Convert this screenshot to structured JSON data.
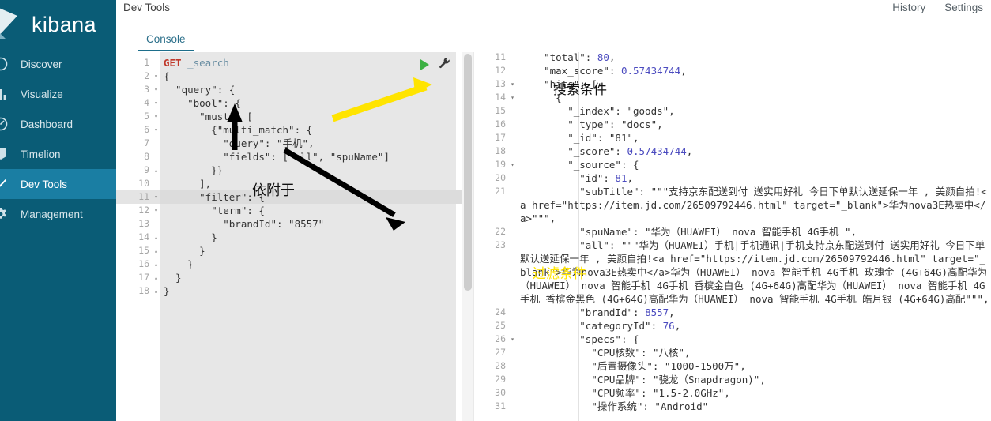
{
  "sidebar": {
    "brand": "kibana",
    "items": [
      {
        "label": "Discover",
        "icon": "compass-icon",
        "active": false
      },
      {
        "label": "Visualize",
        "icon": "barchart-icon",
        "active": false
      },
      {
        "label": "Dashboard",
        "icon": "gauge-icon",
        "active": false
      },
      {
        "label": "Timelion",
        "icon": "clock-icon",
        "active": false
      },
      {
        "label": "Dev Tools",
        "icon": "wrench-icon",
        "active": true
      },
      {
        "label": "Management",
        "icon": "gear-icon",
        "active": false
      }
    ]
  },
  "header": {
    "app_title": "Dev Tools",
    "links": [
      "History",
      "Settings"
    ]
  },
  "tabs": [
    {
      "label": "Console",
      "selected": true
    }
  ],
  "editor": {
    "actions": {
      "run": "play-icon",
      "settings": "wrench-icon"
    },
    "highlight_line": 11,
    "lines": [
      {
        "n": 1,
        "fold": "",
        "text": "GET _search"
      },
      {
        "n": 2,
        "fold": "▾",
        "text": "{"
      },
      {
        "n": 3,
        "fold": "▾",
        "text": "  \"query\": {"
      },
      {
        "n": 4,
        "fold": "▾",
        "text": "    \"bool\": {"
      },
      {
        "n": 5,
        "fold": "▾",
        "text": "      \"must\": ["
      },
      {
        "n": 6,
        "fold": "▾",
        "text": "        {\"multi_match\": {"
      },
      {
        "n": 7,
        "fold": "",
        "text": "          \"query\": \"手机\","
      },
      {
        "n": 8,
        "fold": "",
        "text": "          \"fields\": [\"all\", \"spuName\"]"
      },
      {
        "n": 9,
        "fold": "▴",
        "text": "        }}"
      },
      {
        "n": 10,
        "fold": "",
        "text": "      ],"
      },
      {
        "n": 11,
        "fold": "▾",
        "text": "      \"filter\": {"
      },
      {
        "n": 12,
        "fold": "▾",
        "text": "        \"term\": {"
      },
      {
        "n": 13,
        "fold": "",
        "text": "          \"brandId\": \"8557\""
      },
      {
        "n": 14,
        "fold": "▴",
        "text": "        }"
      },
      {
        "n": 15,
        "fold": "▴",
        "text": "      }"
      },
      {
        "n": 16,
        "fold": "▴",
        "text": "    }"
      },
      {
        "n": 17,
        "fold": "▴",
        "text": "  }"
      },
      {
        "n": 18,
        "fold": "▴",
        "text": "}"
      }
    ]
  },
  "output": {
    "lines": [
      {
        "n": 11,
        "fold": "",
        "text": "    \"total\": 80,"
      },
      {
        "n": 12,
        "fold": "",
        "text": "    \"max_score\": 0.57434744,"
      },
      {
        "n": 13,
        "fold": "▾",
        "text": "    \"hits\": ["
      },
      {
        "n": 14,
        "fold": "▾",
        "text": "      {"
      },
      {
        "n": 15,
        "fold": "",
        "text": "        \"_index\": \"goods\","
      },
      {
        "n": 16,
        "fold": "",
        "text": "        \"_type\": \"docs\","
      },
      {
        "n": 17,
        "fold": "",
        "text": "        \"_id\": \"81\","
      },
      {
        "n": 18,
        "fold": "",
        "text": "        \"_score\": 0.57434744,"
      },
      {
        "n": 19,
        "fold": "▾",
        "text": "        \"_source\": {"
      },
      {
        "n": 20,
        "fold": "",
        "text": "          \"id\": 81,"
      },
      {
        "n": 21,
        "fold": "",
        "text": "          \"subTitle\": \"\"\"支持京东配送到付 送实用好礼 今日下单默认送延保一年 , 美颜自拍!<a href=\"https://item.jd.com/26509792446.html\" target=\"_blank\">华为nova3E热卖中</a>\"\"\","
      },
      {
        "n": 22,
        "fold": "",
        "text": "          \"spuName\": \"华为（HUAWEI） nova 智能手机 4G手机 \","
      },
      {
        "n": 23,
        "fold": "",
        "text": "          \"all\": \"\"\"华为（HUAWEI）手机|手机通讯|手机支持京东配送到付 送实用好礼 今日下单默认送延保一年 , 美颜自拍!<a href=\"https://item.jd.com/26509792446.html\" target=\"_blank\">华为nova3E热卖中</a>华为（HUAWEI） nova 智能手机 4G手机 玫瑰金 (4G+64G)高配华为（HUAWEI） nova 智能手机 4G手机 香槟金白色 (4G+64G)高配华为（HUAWEI） nova 智能手机 4G手机 香槟金黑色 (4G+64G)高配华为（HUAWEI） nova 智能手机 4G手机 皓月银 (4G+64G)高配\"\"\","
      },
      {
        "n": 24,
        "fold": "",
        "text": "          \"brandId\": 8557,"
      },
      {
        "n": 25,
        "fold": "",
        "text": "          \"categoryId\": 76,"
      },
      {
        "n": 26,
        "fold": "▾",
        "text": "          \"specs\": {"
      },
      {
        "n": 27,
        "fold": "",
        "text": "            \"CPU核数\": \"八核\","
      },
      {
        "n": 28,
        "fold": "",
        "text": "            \"后置摄像头\": \"1000-1500万\","
      },
      {
        "n": 29,
        "fold": "",
        "text": "            \"CPU品牌\": \"骁龙（Snapdragon)\","
      },
      {
        "n": 30,
        "fold": "",
        "text": "            \"CPU频率\": \"1.5-2.0GHz\","
      },
      {
        "n": 31,
        "fold": "",
        "text": "            \"操作系统\": \"Android\""
      }
    ]
  },
  "annotations": [
    {
      "id": "anno-search",
      "text": "搜索条件",
      "color": "#111111",
      "arrow": "yellow"
    },
    {
      "id": "anno-attach",
      "text": "依附于",
      "color": "#111111",
      "arrow": "black"
    },
    {
      "id": "anno-filter",
      "text": "过滤条件",
      "color": "#ffe400",
      "arrow": "black"
    }
  ],
  "colors": {
    "sidebar_bg": "#0a5c76",
    "sidebar_active": "#1a7ea3",
    "tab_accent": "#1d6e8b",
    "editor_bg": "#e7e7e7",
    "run_green": "#3cb043",
    "annotation_yellow": "#ffe400"
  }
}
